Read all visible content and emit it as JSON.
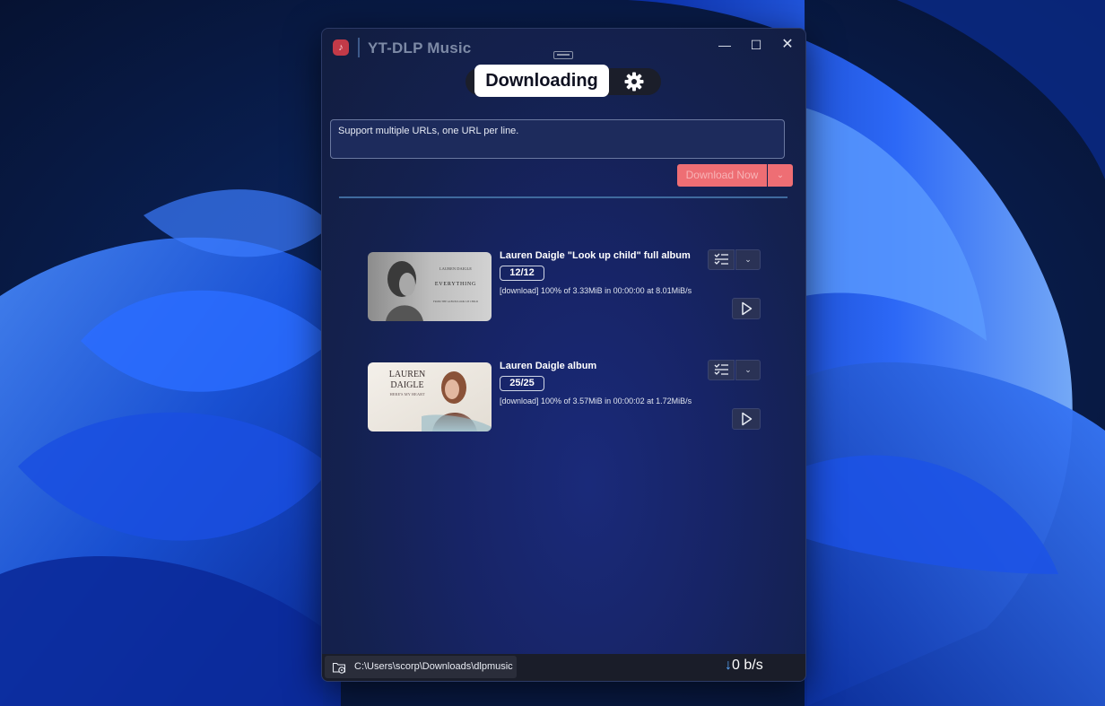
{
  "window": {
    "title": "YT-DLP Music",
    "icon": "music-note-icon",
    "controls": {
      "minimize": "—",
      "maximize": "☐",
      "close": "✕"
    }
  },
  "tabs": {
    "active_label": "Downloading",
    "settings_icon": "gear-icon"
  },
  "url_input": {
    "value": "",
    "placeholder": "Support multiple URLs, one URL per line."
  },
  "download": {
    "button_label": "Download Now",
    "dropdown_glyph": "⌄",
    "accent_color": "#ee6e74"
  },
  "items": [
    {
      "title": "Lauren Daigle \"Look up child\" full album",
      "count": "12/12",
      "status": "[download] 100% of    3.33MiB in 00:00:00 at 8.01MiB/s",
      "thumbnail": {
        "artist": "LAUREN DAIGLE",
        "album": "EVERYTHING",
        "footer": "FROM THE ALBUM LOOK UP CHILD"
      }
    },
    {
      "title": "Lauren Daigle album",
      "count": "25/25",
      "status": "[download] 100% of    3.57MiB in 00:00:02 at 1.72MiB/s",
      "thumbnail": {
        "artist_line1": "LAUREN",
        "artist_line2": "DAIGLE",
        "subtitle": "HERE'S MY HEART"
      }
    }
  ],
  "statusbar": {
    "path": "C:\\Users\\scorp\\Downloads\\dlpmusic",
    "speed_arrow": "↓",
    "speed": "0 b/s"
  }
}
